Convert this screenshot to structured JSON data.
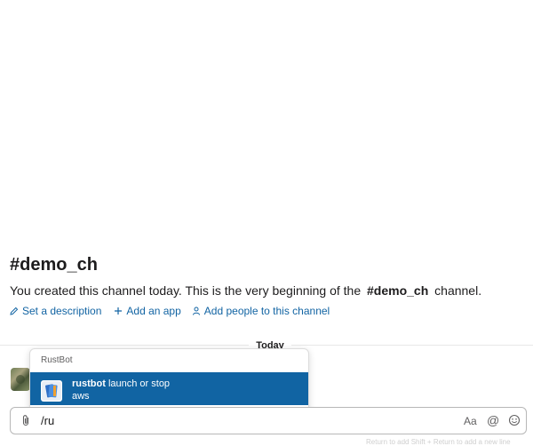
{
  "channel": {
    "title": "#demo_ch",
    "intro_prefix": "You created this channel today. This is the very beginning of the",
    "intro_channel": "#demo_ch",
    "intro_suffix": "channel."
  },
  "actions": {
    "set_description": "Set a description",
    "add_app": "Add an app",
    "add_people": "Add people to this channel"
  },
  "timeline": {
    "today_label": "Today"
  },
  "autocomplete": {
    "header": "RustBot",
    "item": {
      "command": "rustbot",
      "description": "launch or stop",
      "hint": "aws"
    }
  },
  "composer": {
    "value": "/ru",
    "format_label": "Aa",
    "mention_label": "@"
  },
  "footer": {
    "hint": "Return to add   Shift + Return to add a new line"
  },
  "colors": {
    "link": "#1264a3",
    "selection": "#1164a3",
    "border": "#b7b7b7"
  }
}
